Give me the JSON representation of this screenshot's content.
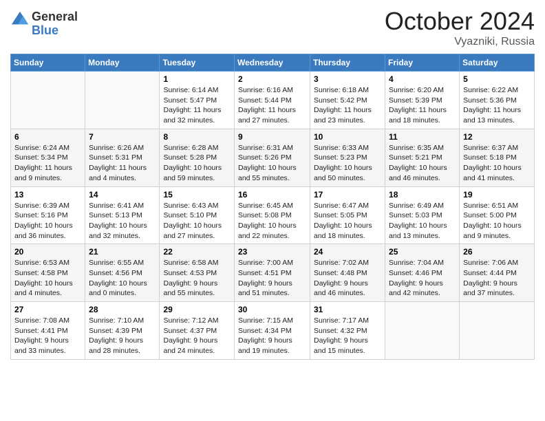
{
  "header": {
    "logo_general": "General",
    "logo_blue": "Blue",
    "month": "October 2024",
    "location": "Vyazniki, Russia"
  },
  "calendar": {
    "days_of_week": [
      "Sunday",
      "Monday",
      "Tuesday",
      "Wednesday",
      "Thursday",
      "Friday",
      "Saturday"
    ],
    "weeks": [
      [
        {
          "day": "",
          "info": ""
        },
        {
          "day": "",
          "info": ""
        },
        {
          "day": "1",
          "info": "Sunrise: 6:14 AM\nSunset: 5:47 PM\nDaylight: 11 hours and 32 minutes."
        },
        {
          "day": "2",
          "info": "Sunrise: 6:16 AM\nSunset: 5:44 PM\nDaylight: 11 hours and 27 minutes."
        },
        {
          "day": "3",
          "info": "Sunrise: 6:18 AM\nSunset: 5:42 PM\nDaylight: 11 hours and 23 minutes."
        },
        {
          "day": "4",
          "info": "Sunrise: 6:20 AM\nSunset: 5:39 PM\nDaylight: 11 hours and 18 minutes."
        },
        {
          "day": "5",
          "info": "Sunrise: 6:22 AM\nSunset: 5:36 PM\nDaylight: 11 hours and 13 minutes."
        }
      ],
      [
        {
          "day": "6",
          "info": "Sunrise: 6:24 AM\nSunset: 5:34 PM\nDaylight: 11 hours and 9 minutes."
        },
        {
          "day": "7",
          "info": "Sunrise: 6:26 AM\nSunset: 5:31 PM\nDaylight: 11 hours and 4 minutes."
        },
        {
          "day": "8",
          "info": "Sunrise: 6:28 AM\nSunset: 5:28 PM\nDaylight: 10 hours and 59 minutes."
        },
        {
          "day": "9",
          "info": "Sunrise: 6:31 AM\nSunset: 5:26 PM\nDaylight: 10 hours and 55 minutes."
        },
        {
          "day": "10",
          "info": "Sunrise: 6:33 AM\nSunset: 5:23 PM\nDaylight: 10 hours and 50 minutes."
        },
        {
          "day": "11",
          "info": "Sunrise: 6:35 AM\nSunset: 5:21 PM\nDaylight: 10 hours and 46 minutes."
        },
        {
          "day": "12",
          "info": "Sunrise: 6:37 AM\nSunset: 5:18 PM\nDaylight: 10 hours and 41 minutes."
        }
      ],
      [
        {
          "day": "13",
          "info": "Sunrise: 6:39 AM\nSunset: 5:16 PM\nDaylight: 10 hours and 36 minutes."
        },
        {
          "day": "14",
          "info": "Sunrise: 6:41 AM\nSunset: 5:13 PM\nDaylight: 10 hours and 32 minutes."
        },
        {
          "day": "15",
          "info": "Sunrise: 6:43 AM\nSunset: 5:10 PM\nDaylight: 10 hours and 27 minutes."
        },
        {
          "day": "16",
          "info": "Sunrise: 6:45 AM\nSunset: 5:08 PM\nDaylight: 10 hours and 22 minutes."
        },
        {
          "day": "17",
          "info": "Sunrise: 6:47 AM\nSunset: 5:05 PM\nDaylight: 10 hours and 18 minutes."
        },
        {
          "day": "18",
          "info": "Sunrise: 6:49 AM\nSunset: 5:03 PM\nDaylight: 10 hours and 13 minutes."
        },
        {
          "day": "19",
          "info": "Sunrise: 6:51 AM\nSunset: 5:00 PM\nDaylight: 10 hours and 9 minutes."
        }
      ],
      [
        {
          "day": "20",
          "info": "Sunrise: 6:53 AM\nSunset: 4:58 PM\nDaylight: 10 hours and 4 minutes."
        },
        {
          "day": "21",
          "info": "Sunrise: 6:55 AM\nSunset: 4:56 PM\nDaylight: 10 hours and 0 minutes."
        },
        {
          "day": "22",
          "info": "Sunrise: 6:58 AM\nSunset: 4:53 PM\nDaylight: 9 hours and 55 minutes."
        },
        {
          "day": "23",
          "info": "Sunrise: 7:00 AM\nSunset: 4:51 PM\nDaylight: 9 hours and 51 minutes."
        },
        {
          "day": "24",
          "info": "Sunrise: 7:02 AM\nSunset: 4:48 PM\nDaylight: 9 hours and 46 minutes."
        },
        {
          "day": "25",
          "info": "Sunrise: 7:04 AM\nSunset: 4:46 PM\nDaylight: 9 hours and 42 minutes."
        },
        {
          "day": "26",
          "info": "Sunrise: 7:06 AM\nSunset: 4:44 PM\nDaylight: 9 hours and 37 minutes."
        }
      ],
      [
        {
          "day": "27",
          "info": "Sunrise: 7:08 AM\nSunset: 4:41 PM\nDaylight: 9 hours and 33 minutes."
        },
        {
          "day": "28",
          "info": "Sunrise: 7:10 AM\nSunset: 4:39 PM\nDaylight: 9 hours and 28 minutes."
        },
        {
          "day": "29",
          "info": "Sunrise: 7:12 AM\nSunset: 4:37 PM\nDaylight: 9 hours and 24 minutes."
        },
        {
          "day": "30",
          "info": "Sunrise: 7:15 AM\nSunset: 4:34 PM\nDaylight: 9 hours and 19 minutes."
        },
        {
          "day": "31",
          "info": "Sunrise: 7:17 AM\nSunset: 4:32 PM\nDaylight: 9 hours and 15 minutes."
        },
        {
          "day": "",
          "info": ""
        },
        {
          "day": "",
          "info": ""
        }
      ]
    ]
  }
}
